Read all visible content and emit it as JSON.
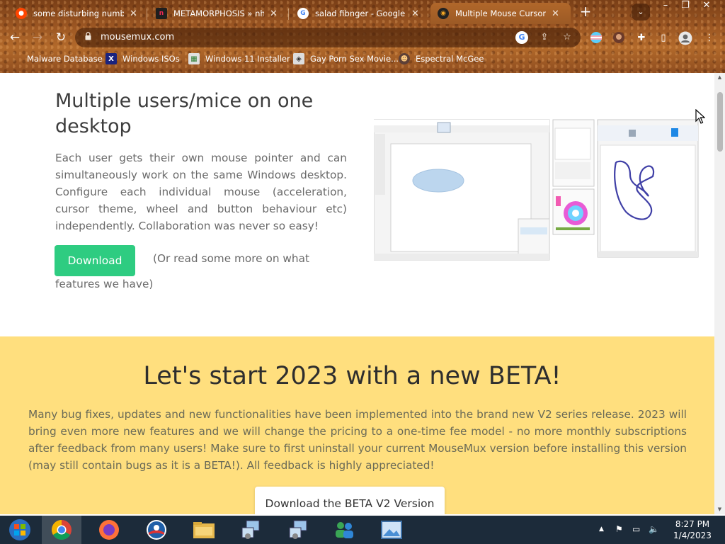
{
  "browser": {
    "tabs": [
      {
        "title": "some disturbing numbers",
        "icon": "reddit-icon"
      },
      {
        "title": "METAMORPHOSIS » nhe",
        "icon": "nhentai-icon"
      },
      {
        "title": "salad fibnger - Google Sea",
        "icon": "google-icon"
      },
      {
        "title": "Multiple Mouse Cursors o",
        "icon": "mousemux-icon"
      }
    ],
    "active_tab": 3,
    "url": "mousemux.com",
    "bookmarks": [
      {
        "label": "Malware Database"
      },
      {
        "label": "Windows ISOs"
      },
      {
        "label": "Windows 11 Installer"
      },
      {
        "label": "Gay Porn Sex Movie..."
      },
      {
        "label": "Espectral McGee"
      }
    ]
  },
  "page": {
    "hero": {
      "title": "Multiple users/mice on one desktop",
      "text": "Each user gets their own mouse pointer and can simultaneously work on the same Windows desktop. Configure each individual mouse (acceleration, cursor theme, wheel and button behaviour etc) independently. Collaboration was never so easy!",
      "download_label": "Download",
      "more_line1": "(Or read some more on what",
      "more_line2": "features we have)"
    },
    "beta": {
      "title": "Let's start 2023 with a new BETA!",
      "text": "Many bug fixes, updates and new functionalities have been implemented into the brand new V2 series release. 2023 will bring even more new features and we will change the pricing to a one-time fee model - no more monthly subscriptions after feedback from many users! Make sure to first uninstall your current MouseMux version before installing this version (may still contain bugs as it is a BETA!). All feedback is highly appreciated!",
      "button_label": "Download the BETA V2 Version"
    }
  },
  "taskbar": {
    "apps": [
      "windows-start-icon",
      "chrome-icon",
      "firefox-icon",
      "obama-icon",
      "file-explorer-icon",
      "network-setup-icon",
      "network-setup-icon",
      "users-icon",
      "image-viewer-icon"
    ],
    "clock_time": "8:27 PM",
    "clock_date": "1/4/2023"
  },
  "colors": {
    "accent_green": "#2ecc81",
    "beta_bg": "#ffdf7e",
    "taskbar": "#1c2b3a"
  }
}
